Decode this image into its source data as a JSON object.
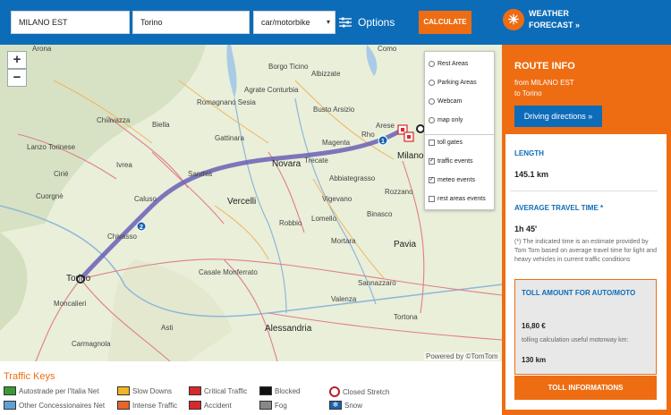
{
  "search": {
    "from_value": "MILANO EST",
    "to_value": "Torino",
    "mode_value": "car/motorbike",
    "options_label": "Options",
    "calculate_label": "CALCULATE"
  },
  "weather": {
    "line1": "WEATHER",
    "line2": "FORECAST »"
  },
  "map": {
    "zoom_in": "+",
    "zoom_out": "−",
    "attribution": "Powered by ©TomTom",
    "route_markers": [
      "1",
      "2"
    ],
    "cities": [
      "Arona",
      "Como",
      "Milano",
      "Novara",
      "Vercelli",
      "Biella",
      "Torino",
      "Ivrea",
      "Agrate Conturbia",
      "Busto Arsizio",
      "Abbiategrasso",
      "Mortara",
      "Pavia",
      "Alessandria",
      "Asti",
      "Casale Monferrato",
      "Chivasso",
      "Cuorgnè",
      "Chiavazza",
      "Carmagnola",
      "Moncalieri",
      "Lomello",
      "Robbio",
      "Borgo Ticino",
      "Albizzate",
      "Rho",
      "Arese",
      "Vigevano",
      "Lanzo Torinese",
      "Cirié",
      "Caluso",
      "Santhià",
      "Gattinara",
      "Romagnano Sesia",
      "Trecate",
      "Magenta",
      "Rozzano",
      "Binasco",
      "Sannazzaro",
      "Valenza",
      "Tortona"
    ]
  },
  "layers": {
    "rest_areas": "Rest Areas",
    "parking_areas": "Parking Areas",
    "webcam": "Webcam",
    "map_only": "map only",
    "toll_gates": "toll gates",
    "traffic_events": "traffic events",
    "meteo_events": "meteo events",
    "rest_areas_events": "rest areas events"
  },
  "route_info": {
    "title": "ROUTE INFO",
    "from_line": "from MILANO EST",
    "to_line": "to Torino",
    "directions_button": "Driving directions »",
    "length_label": "LENGTH",
    "length_value": "145.1 km",
    "time_label": "AVERAGE TRAVEL TIME *",
    "time_value": "1h 45'",
    "time_note": "(*) The indicated time is an estimate provided by Tom Tom based on average travel time for light and heavy vehicles in current traffic conditions",
    "toll_label": "TOLL AMOUNT FOR AUTO/MOTO",
    "toll_value": "16,80 €",
    "toll_note": "tolling calculation useful motorway km:",
    "toll_km": "130 km",
    "toll_button": "TOLL INFORMATIONS"
  },
  "traffic_keys": {
    "title": "Traffic Keys",
    "items": [
      {
        "label": "Autostrade per l'Italia Net",
        "color": "#3a9a3a"
      },
      {
        "label": "Other Concessionaires Net",
        "color": "#5fa0d8"
      },
      {
        "label": "Slow Downs",
        "color": "#f2b522"
      },
      {
        "label": "Intense Traffic",
        "color": "#e8652a"
      },
      {
        "label": "Critical Traffic",
        "color": "#d9272e"
      },
      {
        "label": "Accident",
        "color": "#d9272e"
      },
      {
        "label": "Blocked",
        "color": "#111111"
      },
      {
        "label": "Fog",
        "color": "#888888"
      },
      {
        "label": "Closed Stretch",
        "color": "#b8202a"
      },
      {
        "label": "Snow",
        "color": "#1a63b0"
      }
    ]
  },
  "colors": {
    "brand_blue": "#0d6cb8",
    "brand_orange": "#ee6d12",
    "route": "#6a5fb5"
  }
}
